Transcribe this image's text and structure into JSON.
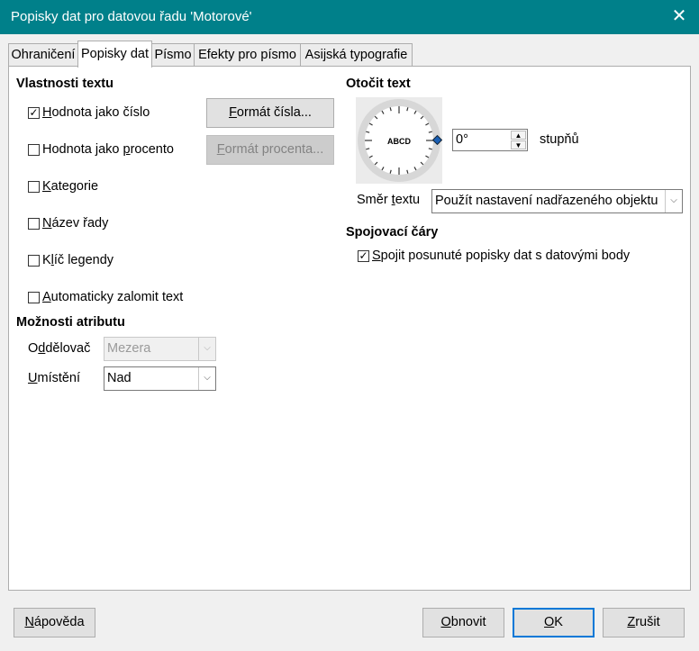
{
  "window": {
    "title": "Popisky dat pro datovou řadu 'Motorové'",
    "close_symbol": "✕"
  },
  "tabs": [
    "Ohraničení",
    "Popisky dat",
    "Písmo",
    "Efekty pro písmo",
    "Asijská typografie"
  ],
  "text_props": {
    "header": "Vlastnosti textu",
    "value_as_number": "Hodnota jako číslo",
    "value_as_percent": "Hodnota jako procento",
    "category": "Kategorie",
    "series_name": "Název řady",
    "legend_key": "Klíč legendy",
    "auto_wrap": "Automaticky zalomit text",
    "number_format_button": "Formát čísla...",
    "percent_format_button": "Formát procenta..."
  },
  "attr_options": {
    "header": "Možnosti atributu",
    "separator_label": "Oddělovač",
    "separator_value": "Mezera",
    "placement_label": "Umístění",
    "placement_value": "Nad"
  },
  "rotate": {
    "header": "Otočit text",
    "dial_text": "ABCD",
    "degrees_value": "0°",
    "degrees_unit": "stupňů",
    "direction_label": "Směr textu",
    "direction_value": "Použít nastavení nadřazeného objektu"
  },
  "leader": {
    "header": "Spojovací čáry",
    "connect_label": "Spojit posunuté popisky dat s datovými body"
  },
  "check_mark": "✓",
  "buttons": {
    "help": "Nápověda",
    "reset": "Obnovit",
    "ok": "OK",
    "cancel": "Zrušit"
  },
  "colors": {
    "titlebar": "#00808a",
    "default_button_border": "#0078d7"
  }
}
